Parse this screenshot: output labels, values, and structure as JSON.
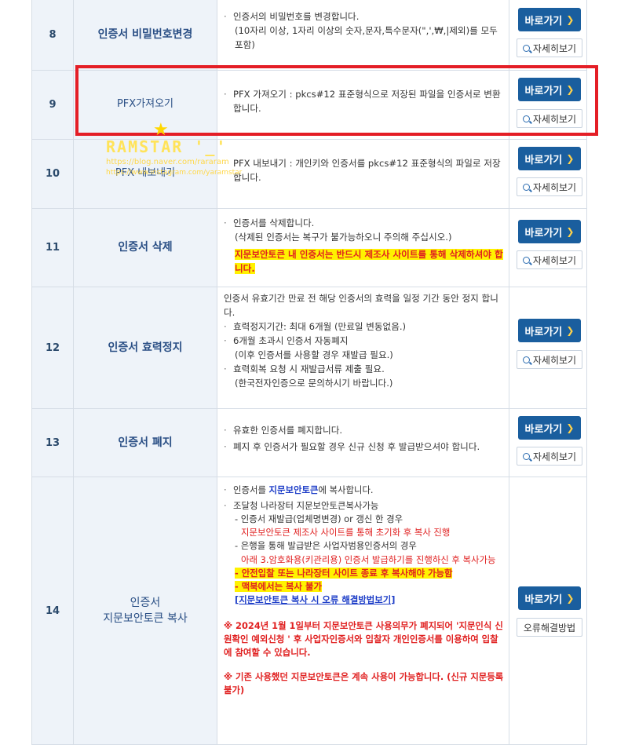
{
  "rows": [
    {
      "num": "8",
      "name": "인증서 비밀번호변경",
      "desc": [
        "인증서의 비밀번호를 변경합니다.",
        "(10자리 이상, 1자리 이상의 숫자,문자,특수문자(\",',₩,|제외)를 모두 포함)"
      ],
      "go": "바로가기",
      "more": "자세히보기"
    },
    {
      "num": "9",
      "name": "PFX가져오기",
      "desc": [
        "PFX 가져오기 : pkcs#12 표준형식으로 저장된 파일을 인증서로 변환합니다."
      ],
      "go": "바로가기",
      "more": "자세히보기"
    },
    {
      "num": "10",
      "name": "PFX 내보내기",
      "desc": [
        "PFX 내보내기 : 개인키와 인증서를 pkcs#12 표준형식의 파일로 저장합니다."
      ],
      "go": "바로가기",
      "more": "자세히보기"
    },
    {
      "num": "11",
      "name": "인증서 삭제",
      "desc": [
        "인증서를 삭제합니다.",
        "(삭제된 인증서는 복구가 불가능하오니 주의해 주십시오.)"
      ],
      "highlight": "지문보안토큰 내 인증서는 반드시 제조사 사이트를 통해 삭제하셔야 합니다.",
      "go": "바로가기",
      "more": "자세히보기"
    },
    {
      "num": "12",
      "name": "인증서 효력정지",
      "intro": "인증서 유효기간 만료 전 해당 인증서의 효력을 일정 기간 동안 정지 합니다.",
      "bullets": [
        {
          "text": "효력정지기간: 최대 6개월 (만료일 변동없음.)"
        },
        {
          "text": "6개월 초과시 인증서 자동폐지",
          "sub": "(이후 인증서를 사용할 경우 재발급 필요.)"
        },
        {
          "text": "효력회복 요청 시 재발급서류 제출 필요.",
          "sub": "(한국전자인증으로 문의하시기 바랍니다.)"
        }
      ],
      "go": "바로가기",
      "more": "자세히보기"
    },
    {
      "num": "13",
      "name": "인증서 폐지",
      "desc": [
        "유효한 인증서를 폐지합니다.",
        "폐지 후 인증서가 필요할 경우 신규 신청 후 발급받으셔야 합니다."
      ],
      "go": "바로가기",
      "more": "자세히보기"
    },
    {
      "num": "14",
      "name_line1": "인증서",
      "name_line2": "지문보안토큰 복사",
      "b1_pre": "인증서를 ",
      "b1_kw": "지문보안토큰",
      "b1_post": "에 복사합니다.",
      "b2": "조달청 나라장터 지문보안토큰복사가능",
      "s1": "- 인증서 재발급(업체명변경) or 갱신 한 경우",
      "s1_red": "지문보안토큰 제조사 사이트를 통해 초기화 후 복사 진행",
      "s2": "- 은행을 통해 발급받은 사업자범용인증서의 경우",
      "s2_red": "아래 3.암호화용(키관리용) 인증서 발급하기를 진행하신 후 복사가능",
      "hl1": "- 안전입찰 또는 나라장터 사이트 종료 후 복사해야 가능함",
      "hl2": "- 맥북에서는 복사 불가",
      "link": "[지문보안토큰 복사 시 오류 해결방법보기]",
      "note1": "※ 2024년 1월 1일부터 지문보안토큰 사용의무가 폐지되어 '지문인식 신원확인 예외신청 ' 후 사업자인증서와 입찰자 개인인증서를 이용하여 입찰에 참여할 수 있습니다.",
      "note2": "※ 기존 사용했던 지문보안토큰은 계속 사용이 가능합니다. (신규 지문등록 불가)",
      "go": "바로가기",
      "more": "오류해결방법"
    }
  ],
  "watermark": {
    "brand": "RAMSTAR '_'",
    "url1": "https://blog.naver.com/rararam",
    "url2": "https://www.instagram.com/yaramstar"
  },
  "colors": {
    "button": "#1a5e9e",
    "highlight": "#fff200",
    "alert": "#e02020",
    "annotation_box": "#e41e26"
  },
  "icons": {
    "go": "chevron-right-icon",
    "more": "magnifier-plus-icon"
  }
}
